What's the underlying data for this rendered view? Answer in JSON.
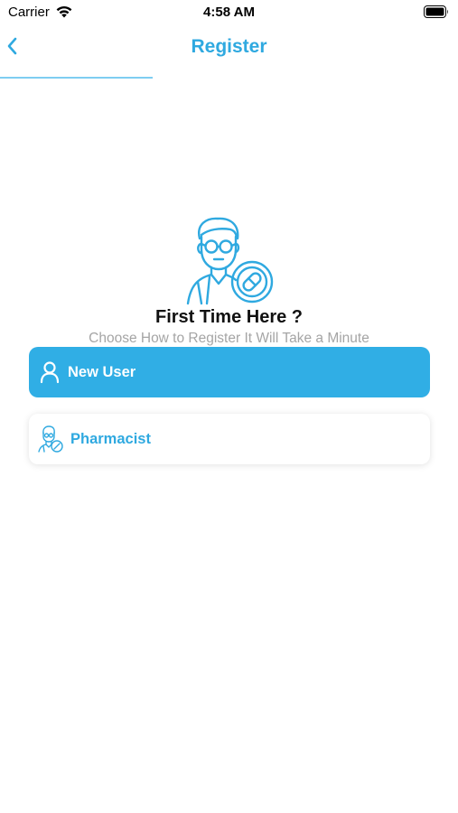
{
  "status_bar": {
    "carrier": "Carrier",
    "time": "4:58 AM",
    "wifi_icon": "wifi-icon",
    "battery_icon": "battery-icon"
  },
  "nav": {
    "title": "Register",
    "back_icon": "chevron-left-icon"
  },
  "hero": {
    "icon": "pharmacist-avatar-icon",
    "title": "First Time Here ?",
    "subtitle": "Choose How to Register It Will Take a Minute"
  },
  "options": [
    {
      "label": "New User",
      "icon": "user-icon",
      "selected": true
    },
    {
      "label": "Pharmacist",
      "icon": "pharmacist-icon",
      "selected": false
    }
  ],
  "colors": {
    "accent": "#30aee5",
    "title_blue": "#2fa9e0",
    "subtitle_gray": "#a5a5a5",
    "white": "#ffffff"
  }
}
